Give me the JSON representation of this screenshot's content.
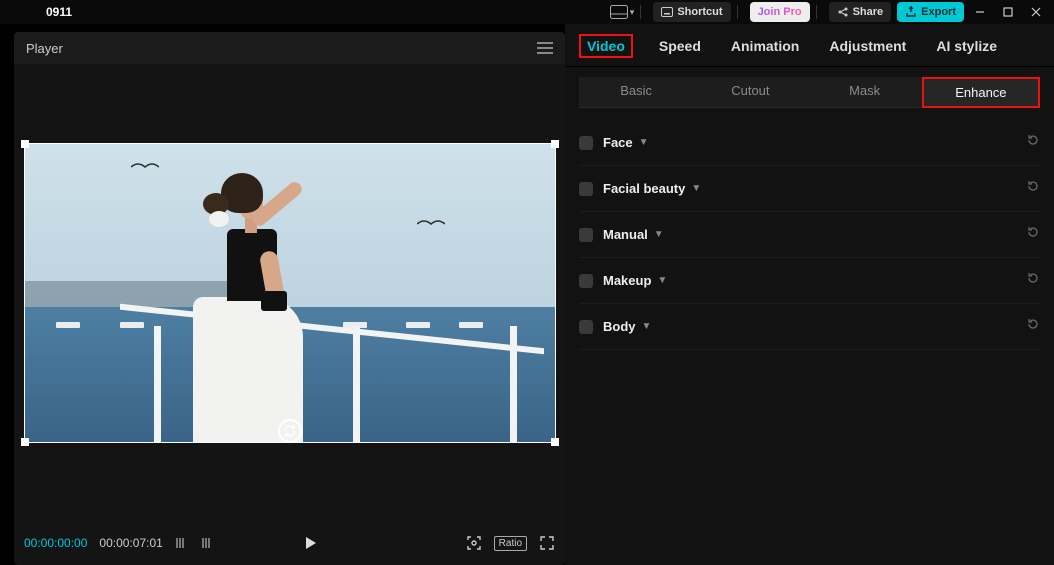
{
  "topbar": {
    "project_name": "0911",
    "shortcut_label": "Shortcut",
    "join_pro_label": "Join Pro",
    "share_label": "Share",
    "export_label": "Export"
  },
  "player": {
    "header_label": "Player",
    "current_time": "00:00:00:00",
    "duration": "00:00:07:01",
    "ratio_label": "Ratio"
  },
  "inspector": {
    "tabs": [
      {
        "id": "video",
        "label": "Video",
        "active": true
      },
      {
        "id": "speed",
        "label": "Speed",
        "active": false
      },
      {
        "id": "animation",
        "label": "Animation",
        "active": false
      },
      {
        "id": "adjustment",
        "label": "Adjustment",
        "active": false
      },
      {
        "id": "aistylize",
        "label": "AI stylize",
        "active": false
      }
    ],
    "subtabs": [
      {
        "id": "basic",
        "label": "Basic",
        "active": false
      },
      {
        "id": "cutout",
        "label": "Cutout",
        "active": false
      },
      {
        "id": "mask",
        "label": "Mask",
        "active": false
      },
      {
        "id": "enhance",
        "label": "Enhance",
        "active": true
      }
    ],
    "sections": [
      {
        "id": "face",
        "label": "Face"
      },
      {
        "id": "facial_beauty",
        "label": "Facial beauty"
      },
      {
        "id": "manual",
        "label": "Manual"
      },
      {
        "id": "makeup",
        "label": "Makeup"
      },
      {
        "id": "body",
        "label": "Body"
      }
    ]
  }
}
